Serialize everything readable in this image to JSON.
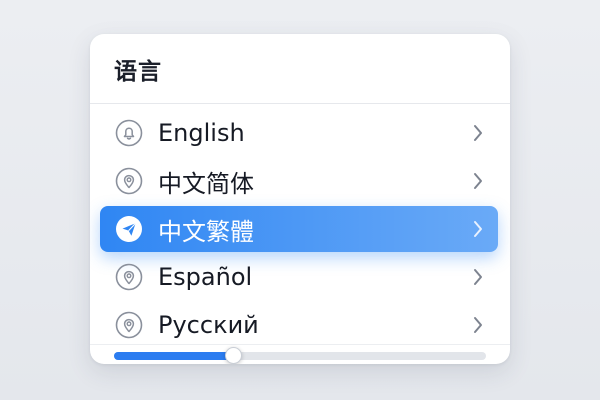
{
  "panel": {
    "title": "语言"
  },
  "languages": [
    {
      "label": "English",
      "icon": "bell-icon",
      "selected": false
    },
    {
      "label": "中文简体",
      "icon": "location-pin-icon",
      "selected": false
    },
    {
      "label": "中文繁體",
      "icon": "paper-plane-icon",
      "selected": true
    },
    {
      "label": "Español",
      "icon": "location-pin-icon",
      "selected": false
    },
    {
      "label": "Русский",
      "icon": "location-pin-icon",
      "selected": false
    }
  ],
  "slider": {
    "value": 0.32
  },
  "colors": {
    "accent": "#2f86f3",
    "accent_light": "#6aaaf7",
    "icon_gray": "#8a909c"
  }
}
